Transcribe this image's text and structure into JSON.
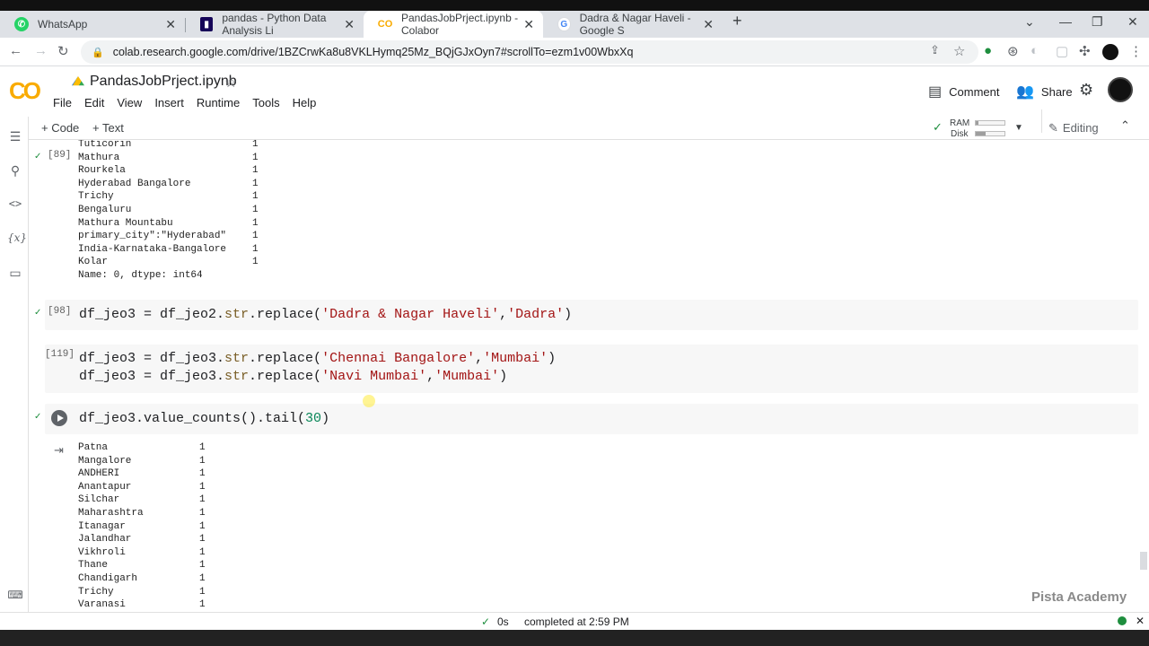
{
  "browser": {
    "tabs": [
      {
        "title": "WhatsApp",
        "icon": "whatsapp-icon",
        "color": "#25d366"
      },
      {
        "title": "pandas - Python Data Analysis Li",
        "icon": "pandas-icon",
        "color": "#150458"
      },
      {
        "title": "PandasJobPrject.ipynb - Colabor",
        "icon": "colab-icon",
        "color": "#f9ab00"
      },
      {
        "title": "Dadra & Nagar Haveli - Google S",
        "icon": "google-icon",
        "color": "#4285f4"
      }
    ],
    "url": "colab.research.google.com/drive/1BZCrwKa8u8VKLHymq25Mz_BQjGJxOyn7#scrollTo=ezm1v00WbxXq"
  },
  "colab": {
    "logo": "CO",
    "notebook_title": "PandasJobPrject.ipynb",
    "menu": [
      "File",
      "Edit",
      "View",
      "Insert",
      "Runtime",
      "Tools",
      "Help"
    ],
    "comment_label": "Comment",
    "share_label": "Share",
    "toolbar": {
      "code_label": "+ Code",
      "text_label": "+ Text",
      "ram_label": "RAM",
      "disk_label": "Disk",
      "ram_fraction": 0.1,
      "disk_fraction": 0.35,
      "editing_label": "Editing"
    }
  },
  "cells": {
    "cell89": {
      "exec_count": "[89]",
      "partial_top": "Tuticorin",
      "rows": [
        {
          "name": "Tuticorin",
          "count": "1"
        },
        {
          "name": "Mathura",
          "count": "1"
        },
        {
          "name": "Rourkela",
          "count": "1"
        },
        {
          "name": "Hyderabad Bangalore",
          "count": "1"
        },
        {
          "name": "Trichy",
          "count": "1"
        },
        {
          "name": "Bengaluru",
          "count": "1"
        },
        {
          "name": "Mathura Mountabu",
          "count": "1"
        },
        {
          "name": "primary_city\":\"Hyderabad\"",
          "count": "1"
        },
        {
          "name": "India-Karnataka-Bangalore",
          "count": "1"
        },
        {
          "name": "Kolar",
          "count": "1"
        }
      ],
      "footer": "Name: 0, dtype: int64"
    },
    "cell98": {
      "exec_count": "[98]",
      "lines": [
        {
          "pre": "df_jeo3 = df_jeo2.",
          "meth": "str",
          "mid": ".replace(",
          "s1": "'Dadra & Nagar Haveli'",
          "sep": ",",
          "s2": "'Dadra'",
          "post": ")"
        }
      ]
    },
    "cell119": {
      "exec_count": "[119]",
      "lines": [
        {
          "pre": "df_jeo3 = df_jeo3.",
          "meth": "str",
          "mid": ".replace(",
          "s1": "'Chennai Bangalore'",
          "sep": ",",
          "s2": "'Mumbai'",
          "post": ")"
        },
        {
          "pre": "df_jeo3 = df_jeo3.",
          "meth": "str",
          "mid": ".replace(",
          "s1": "'Navi Mumbai'",
          "sep": ",",
          "s2": "'Mumbai'",
          "post": ")"
        }
      ]
    },
    "cellRun": {
      "code_pre": "df_jeo3.value_counts().tail(",
      "code_num": "30",
      "code_post": ")",
      "rows": [
        {
          "name": "Patna",
          "count": "1"
        },
        {
          "name": "Mangalore",
          "count": "1"
        },
        {
          "name": "ANDHERI",
          "count": "1"
        },
        {
          "name": "Anantapur",
          "count": "1"
        },
        {
          "name": "Silchar",
          "count": "1"
        },
        {
          "name": "Maharashtra",
          "count": "1"
        },
        {
          "name": "Itanagar",
          "count": "1"
        },
        {
          "name": "Jalandhar",
          "count": "1"
        },
        {
          "name": "Vikhroli",
          "count": "1"
        },
        {
          "name": "Thane",
          "count": "1"
        },
        {
          "name": "Chandigarh",
          "count": "1"
        },
        {
          "name": "Trichy",
          "count": "1"
        },
        {
          "name": "Varanasi",
          "count": "1"
        }
      ]
    }
  },
  "status": {
    "duration": "0s",
    "completed": "completed at 2:59 PM"
  },
  "watermark": "Pista Academy"
}
